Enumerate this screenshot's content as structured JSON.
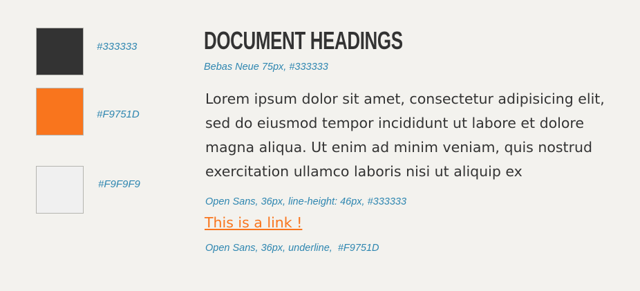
{
  "swatches": [
    {
      "hex": "#333333",
      "color": "#333333"
    },
    {
      "hex": "#F9751D",
      "color": "#F9751D"
    },
    {
      "hex": "#F9F9F9",
      "color": "#F0F0F0"
    }
  ],
  "heading": {
    "text": "Document Headings",
    "note": "Bebas Neue 75px, #333333"
  },
  "paragraph": {
    "text": "Lorem ipsum dolor sit amet, consectetur adipisicing elit, sed do eiusmod tempor incididunt ut labore et dolore magna aliqua. Ut enim ad minim veniam, quis nostrud exercitation ullamco laboris nisi ut aliquip ex",
    "note": "Open Sans, 36px, line-height: 46px, #333333"
  },
  "link": {
    "text": "This is a link !",
    "note": "Open Sans, 36px, underline,  #F9751D"
  }
}
